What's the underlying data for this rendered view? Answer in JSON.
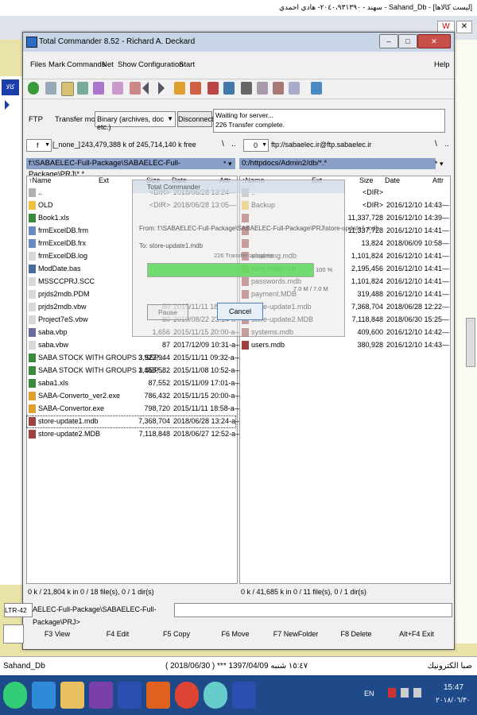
{
  "top_bar": {
    "title": "سهند - ٢٠٤٠،٩٣١٣٩٠- هادي احمدي - Sahand_Db - [ليست كالاها]"
  },
  "window": {
    "title": "Total Commander 8.52 - Richard A. Deckard",
    "min": "–",
    "max": "□",
    "close": "✕"
  },
  "menu": [
    "Files",
    "Mark",
    "Commands",
    "Net",
    "Show",
    "Configuration",
    "Start",
    "Help"
  ],
  "ftp": {
    "label": "FTP",
    "transfer_mode_label": "Transfer mode",
    "transfer_mode_value": "Binary (archives, doc etc.)",
    "disconnect": "Disconnect",
    "log": [
      "Waiting for server...",
      "226 Transfer complete."
    ]
  },
  "left_drive": {
    "drive": "f",
    "label": "[_none_]",
    "free": "243,479,388 k of 245,714,140 k free",
    "path": "f:\\SABAELEC-Full-Package\\SABAELEC-Full-Package\\PRJ\\*.*"
  },
  "right_drive": {
    "drive": "0",
    "label": "ftp://sabaelec.ir@ftp.sabaelec.ir",
    "path": "0:/httpdocs/Admin2/db/*.*"
  },
  "columns": {
    "name": "Name",
    "ext": "Ext",
    "size": "Size",
    "date": "Date",
    "attr": "Attr",
    "sort_icon": "arrow-up-icon"
  },
  "left_files": [
    {
      "name": "..",
      "size": "<DIR>",
      "date": "2018/06/28 13:24—",
      "icon": "up-icon"
    },
    {
      "name": "OLD",
      "size": "<DIR>",
      "date": "2018/06/28 13:05—",
      "icon": "folder-icon"
    },
    {
      "name": "Book1.xls",
      "size": "",
      "date": "",
      "icon": "excel-icon"
    },
    {
      "name": "frmExcelDB.frm",
      "size": "",
      "date": "",
      "icon": "form-icon"
    },
    {
      "name": "frmExcelDB.frx",
      "size": "",
      "date": "",
      "icon": "form-icon"
    },
    {
      "name": "frmExcelDB.log",
      "size": "",
      "date": "",
      "icon": "file-icon"
    },
    {
      "name": "ModDate.bas",
      "size": "",
      "date": "",
      "icon": "module-icon"
    },
    {
      "name": "MSSCCPRJ.SCC",
      "size": "",
      "date": "",
      "icon": "file-icon"
    },
    {
      "name": "prjds2mdb.PDM",
      "size": "",
      "date": "",
      "icon": "file-icon"
    },
    {
      "name": "prjds2mdb.vbw",
      "size": "80",
      "date": "2015/11/11 18:22-a—",
      "icon": "file-icon"
    },
    {
      "name": "Project7eS.vbw",
      "size": "80",
      "date": "2010/08/22 23:14-a—",
      "icon": "file-icon"
    },
    {
      "name": "saba.vbp",
      "size": "1,656",
      "date": "2015/11/15 20:00-a—",
      "icon": "vb-icon"
    },
    {
      "name": "saba.vbw",
      "size": "87",
      "date": "2017/12/09 10:31-a—",
      "icon": "file-icon"
    },
    {
      "name": "SABA STOCK WITH GROUPS 3 SEP ..",
      "size": "3,922,944",
      "date": "2015/11/11 09:32-a—",
      "icon": "excel-icon"
    },
    {
      "name": "SABA STOCK WITH GROUPS 3 SEP ..",
      "size": "1,458,582",
      "date": "2015/11/08 10:52-a—",
      "icon": "excel-icon"
    },
    {
      "name": "saba1.xls",
      "size": "87,552",
      "date": "2015/11/09 17:01-a—",
      "icon": "excel-icon"
    },
    {
      "name": "SABA-Converto_ver2.exe",
      "size": "786,432",
      "date": "2015/11/15 20:00-a—",
      "icon": "exe-icon"
    },
    {
      "name": "SABA-Convertor.exe",
      "size": "798,720",
      "date": "2015/11/11 18:58-a—",
      "icon": "exe-icon"
    },
    {
      "name": "store-update1.mdb",
      "size": "7,368,704",
      "date": "2018/06/28 13:24-a—",
      "icon": "mdb-icon"
    },
    {
      "name": "store-update2.MDB",
      "size": "7,118,848",
      "date": "2018/06/27 12:52-a—",
      "icon": "mdb-icon"
    }
  ],
  "right_files": [
    {
      "name": "..",
      "size": "<DIR>",
      "date": "",
      "icon": "up-icon"
    },
    {
      "name": "Backup",
      "size": "<DIR>",
      "date": "2016/12/10 14:43—",
      "icon": "folder-icon"
    },
    {
      "name": "",
      "size": "11,337,728",
      "date": "2016/12/10 14:39—",
      "icon": "mdb-icon"
    },
    {
      "name": "",
      "size": "11,337,728",
      "date": "2016/12/10 14:41—",
      "icon": "mdb-icon"
    },
    {
      "name": "",
      "size": "13,824",
      "date": "2018/06/09 10:58—",
      "icon": "mdb-icon"
    },
    {
      "name": "elearning.mdb",
      "size": "1,101,824",
      "date": "2016/12/10 14:41—",
      "icon": "mdb-icon"
    },
    {
      "name": "New folder.zip",
      "size": "2,195,456",
      "date": "2016/12/10 14:41—",
      "icon": "zip-icon"
    },
    {
      "name": "passwords.mdb",
      "size": "1,101,824",
      "date": "2016/12/10 14:41—",
      "icon": "mdb-icon"
    },
    {
      "name": "payment.MDB",
      "size": "319,488",
      "date": "2016/12/10 14:41—",
      "icon": "mdb-icon"
    },
    {
      "name": "store-update1.mdb",
      "size": "7,368,704",
      "date": "2018/06/28 12:22—",
      "icon": "mdb-icon"
    },
    {
      "name": "store-update2.MDB",
      "size": "7,118,848",
      "date": "2018/06/30 15:25—",
      "icon": "mdb-icon"
    },
    {
      "name": "systems.mdb",
      "size": "409,600",
      "date": "2016/12/10 14:42—",
      "icon": "mdb-icon"
    },
    {
      "name": "users.mdb",
      "size": "380,928",
      "date": "2016/12/10 14:43—",
      "icon": "mdb-icon"
    }
  ],
  "left_status": "0 k / 21,804 k in 0 / 18 file(s), 0 / 1 dir(s)",
  "right_status": "0 k / 41,685 k in 0 / 11 file(s), 0 / 1 dir(s)",
  "command_line": {
    "prompt": "LTR-42",
    "path": "AELEC-Full-Package\\SABAELEC-Full-Package\\PRJ>"
  },
  "fkeys": [
    "F3 View",
    "F4 Edit",
    "F5 Copy",
    "F6 Move",
    "F7 NewFolder",
    "F8 Delete",
    "Alt+F4 Exit"
  ],
  "dialog": {
    "title": "Total Commander",
    "from_label": "From: f:\\SABAELEC-Full-Package\\SABAELEC-Full-Package\\PRJ\\store-update1.mdb",
    "to_label": "To: store-update1.mdb",
    "status": "226 Transfer complete.",
    "progress": 1.0,
    "percent": "100 %",
    "bytes": "7.0 M / 7.0 M",
    "pause": "Pause",
    "cancel": "Cancel"
  },
  "bottom_bar": {
    "app": "Sahand_Db",
    "date": "( 2018/06/30 )  *** 1397/04/09 ١٥:٤٧  شنبه",
    "company": "صبا الكترونيك"
  },
  "taskbar": {
    "lang": "EN",
    "time": "15:47",
    "date": "٢٠١٨/٠٦/٣٠"
  }
}
